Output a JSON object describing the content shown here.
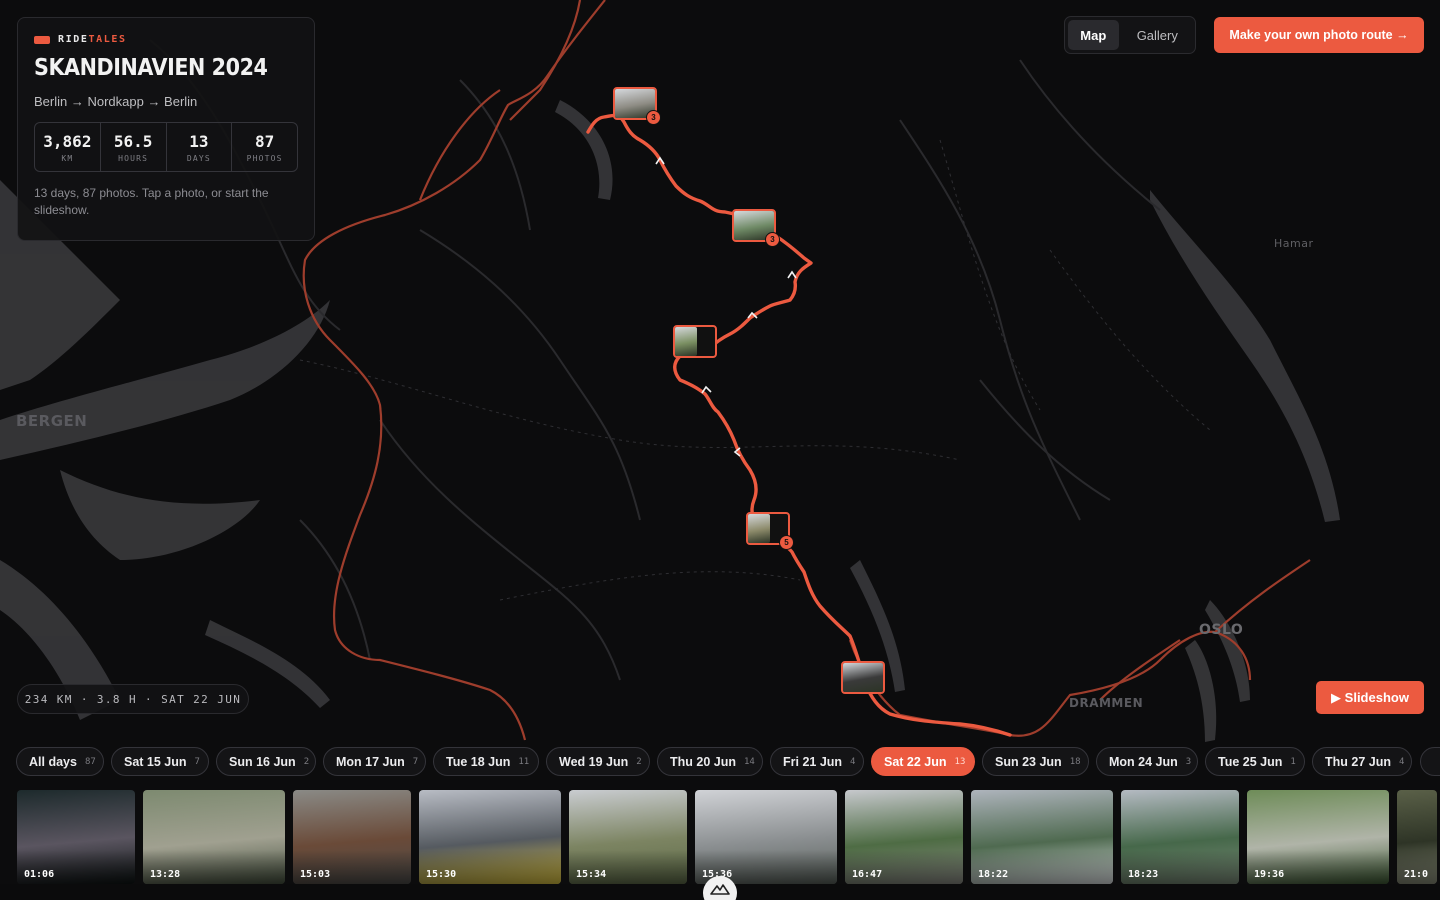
{
  "brand": {
    "part1": "RIDE",
    "part2": "TALES"
  },
  "trip": {
    "title": "SKANDINAVIEN 2024",
    "route": "Berlin → Nordkapp → Berlin",
    "stats": [
      {
        "value": "3,862",
        "label": "KM"
      },
      {
        "value": "56.5",
        "label": "HOURS"
      },
      {
        "value": "13",
        "label": "DAYS"
      },
      {
        "value": "87",
        "label": "PHOTOS"
      }
    ],
    "description": "13 days, 87 photos. Tap a photo, or start the slideshow."
  },
  "view_toggle": {
    "map": "Map",
    "gallery": "Gallery",
    "active": "map"
  },
  "cta_label": "Make your own photo route →",
  "map": {
    "labels": [
      "BERGEN",
      "Hamar",
      "OSLO",
      "DRAMMEN"
    ],
    "route_color": "#ec5a40",
    "photo_clusters": [
      "3",
      "3",
      "",
      "5",
      ""
    ]
  },
  "day_summary": "234 KM · 3.8 H · SAT 22 JUN",
  "slideshow_label": "▶ Slideshow",
  "days": [
    {
      "label": "All days",
      "count": "87",
      "active": false
    },
    {
      "label": "Sat 15 Jun",
      "count": "7",
      "active": false
    },
    {
      "label": "Sun 16 Jun",
      "count": "2",
      "active": false
    },
    {
      "label": "Mon 17 Jun",
      "count": "7",
      "active": false
    },
    {
      "label": "Tue 18 Jun",
      "count": "11",
      "active": false
    },
    {
      "label": "Wed 19 Jun",
      "count": "2",
      "active": false
    },
    {
      "label": "Thu 20 Jun",
      "count": "14",
      "active": false
    },
    {
      "label": "Fri 21 Jun",
      "count": "4",
      "active": false
    },
    {
      "label": "Sat 22 Jun",
      "count": "13",
      "active": true
    },
    {
      "label": "Sun 23 Jun",
      "count": "18",
      "active": false
    },
    {
      "label": "Mon 24 Jun",
      "count": "3",
      "active": false
    },
    {
      "label": "Tue 25 Jun",
      "count": "1",
      "active": false
    },
    {
      "label": "Thu 27 Jun",
      "count": "4",
      "active": false
    }
  ],
  "photos": [
    {
      "time": "01:06",
      "colors": [
        "#1d2a2c",
        "#5a5560",
        "#0e1414"
      ]
    },
    {
      "time": "13:28",
      "colors": [
        "#7d8a70",
        "#a0a090",
        "#45503e"
      ]
    },
    {
      "time": "15:03",
      "colors": [
        "#8a8a86",
        "#6a4a38",
        "#4c4c4a"
      ]
    },
    {
      "time": "15:30",
      "colors": [
        "#b8bcc4",
        "#555a60",
        "#d8c040"
      ]
    },
    {
      "time": "15:34",
      "colors": [
        "#c9ccd0",
        "#7c8462",
        "#5d6a48"
      ]
    },
    {
      "time": "15:36",
      "colors": [
        "#d0d2d6",
        "#8a8e90",
        "#58605a"
      ]
    },
    {
      "time": "16:47",
      "colors": [
        "#c6c8cc",
        "#4e6c44",
        "#8a8a84"
      ]
    },
    {
      "time": "18:22",
      "colors": [
        "#aeb4bc",
        "#4f6a50",
        "#dce0e2"
      ]
    },
    {
      "time": "18:23",
      "colors": [
        "#b4bac2",
        "#46684a",
        "#7a8a78"
      ]
    },
    {
      "time": "19:36",
      "colors": [
        "#6e8c58",
        "#b0b4a8",
        "#3e5a34"
      ]
    },
    {
      "time": "21:0",
      "colors": [
        "#5a6048",
        "#2e3426",
        "#8a8e7a"
      ]
    }
  ]
}
